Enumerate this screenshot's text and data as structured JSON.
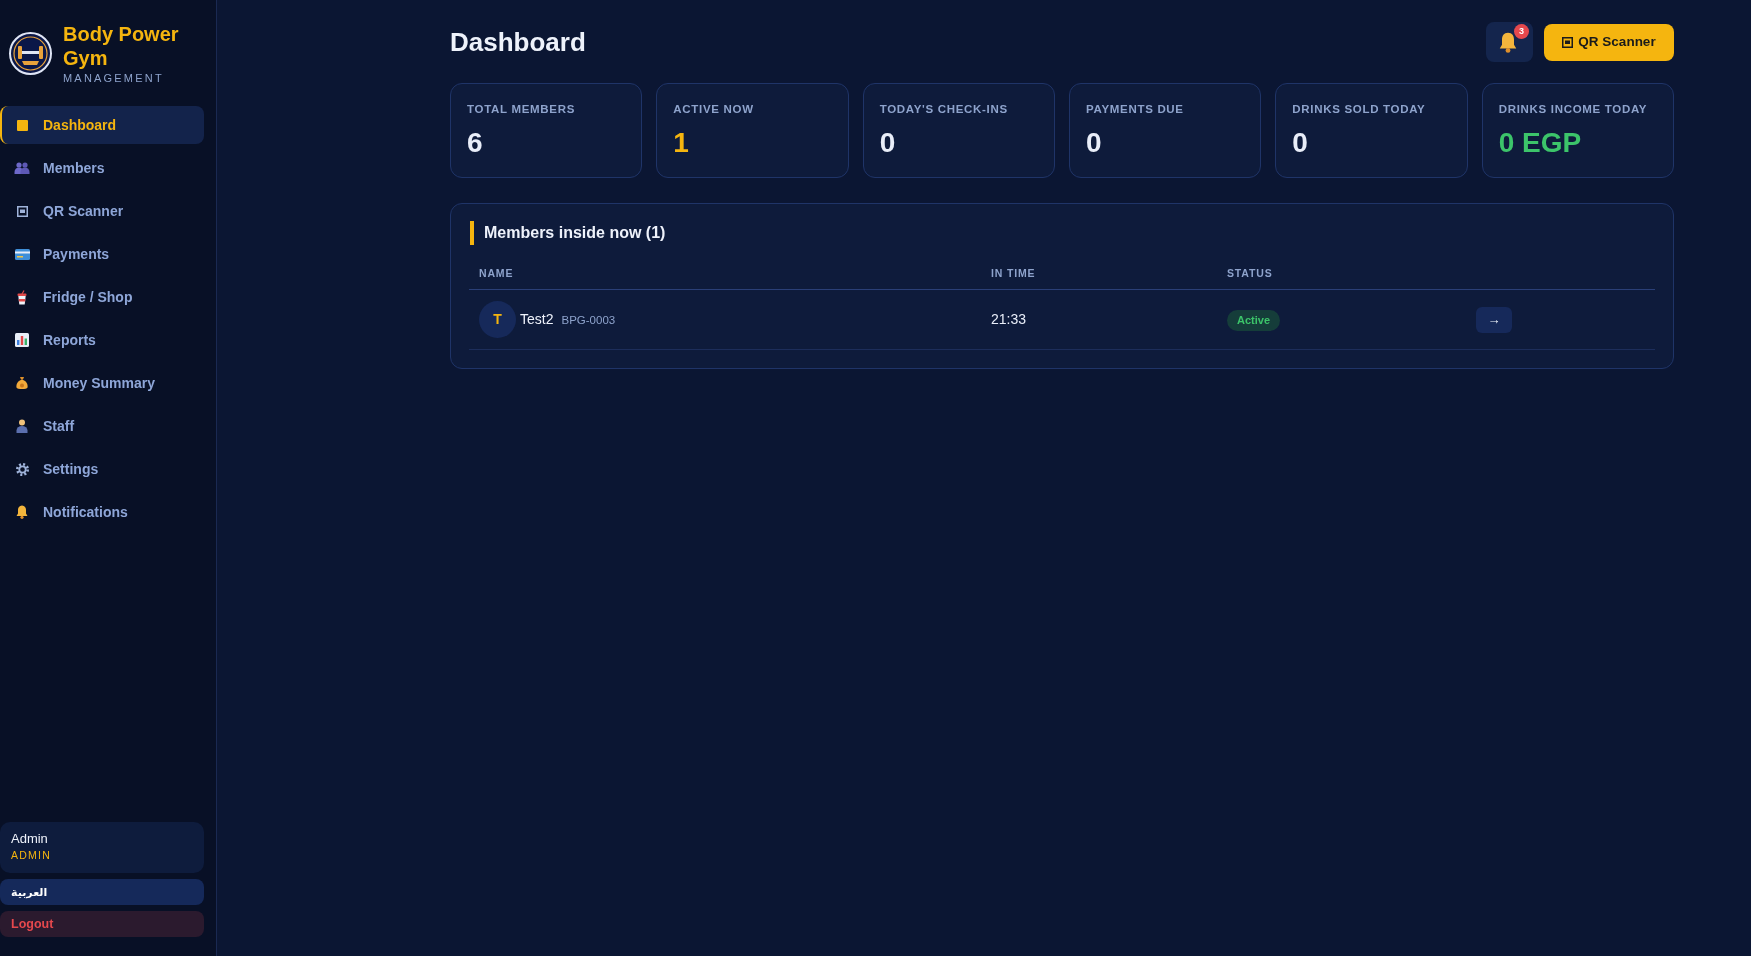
{
  "sidebar": {
    "brand": {
      "title": "Body Power Gym",
      "subtitle": "MANAGEMENT"
    },
    "items": [
      {
        "label": "Dashboard",
        "selected": true
      },
      {
        "label": "Members",
        "selected": false
      },
      {
        "label": "QR Scanner",
        "selected": false
      },
      {
        "label": "Payments",
        "selected": false
      },
      {
        "label": "Fridge / Shop",
        "selected": false
      },
      {
        "label": "Reports",
        "selected": false
      },
      {
        "label": "Money Summary",
        "selected": false
      },
      {
        "label": "Staff",
        "selected": false
      },
      {
        "label": "Settings",
        "selected": false
      },
      {
        "label": "Notifications",
        "selected": false
      }
    ],
    "user": {
      "name": "Admin",
      "role": "ADMIN"
    },
    "language_button": "العربية",
    "logout_button": "Logout"
  },
  "header": {
    "title": "Dashboard",
    "notification_count": "3",
    "qr_button": "QR Scanner"
  },
  "stats": [
    {
      "label": "TOTAL MEMBERS",
      "value": "6",
      "color": "#e9eef9"
    },
    {
      "label": "ACTIVE NOW",
      "value": "1",
      "color": "#f5b50f"
    },
    {
      "label": "TODAY'S CHECK-INS",
      "value": "0",
      "color": "#e9eef9"
    },
    {
      "label": "PAYMENTS DUE",
      "value": "0",
      "color": "#e9eef9"
    },
    {
      "label": "DRINKS SOLD TODAY",
      "value": "0",
      "color": "#e9eef9"
    },
    {
      "label": "DRINKS INCOME TODAY",
      "value": "0 EGP",
      "color": "#3cc46a"
    }
  ],
  "members_inside": {
    "title": "Members inside now (1)",
    "columns": [
      "NAME",
      "IN TIME",
      "STATUS"
    ],
    "rows": [
      {
        "initial": "T",
        "name": "Test2",
        "member_id": "BPG-0003",
        "in_time": "21:33",
        "status": "Active",
        "action": "→"
      }
    ]
  }
}
